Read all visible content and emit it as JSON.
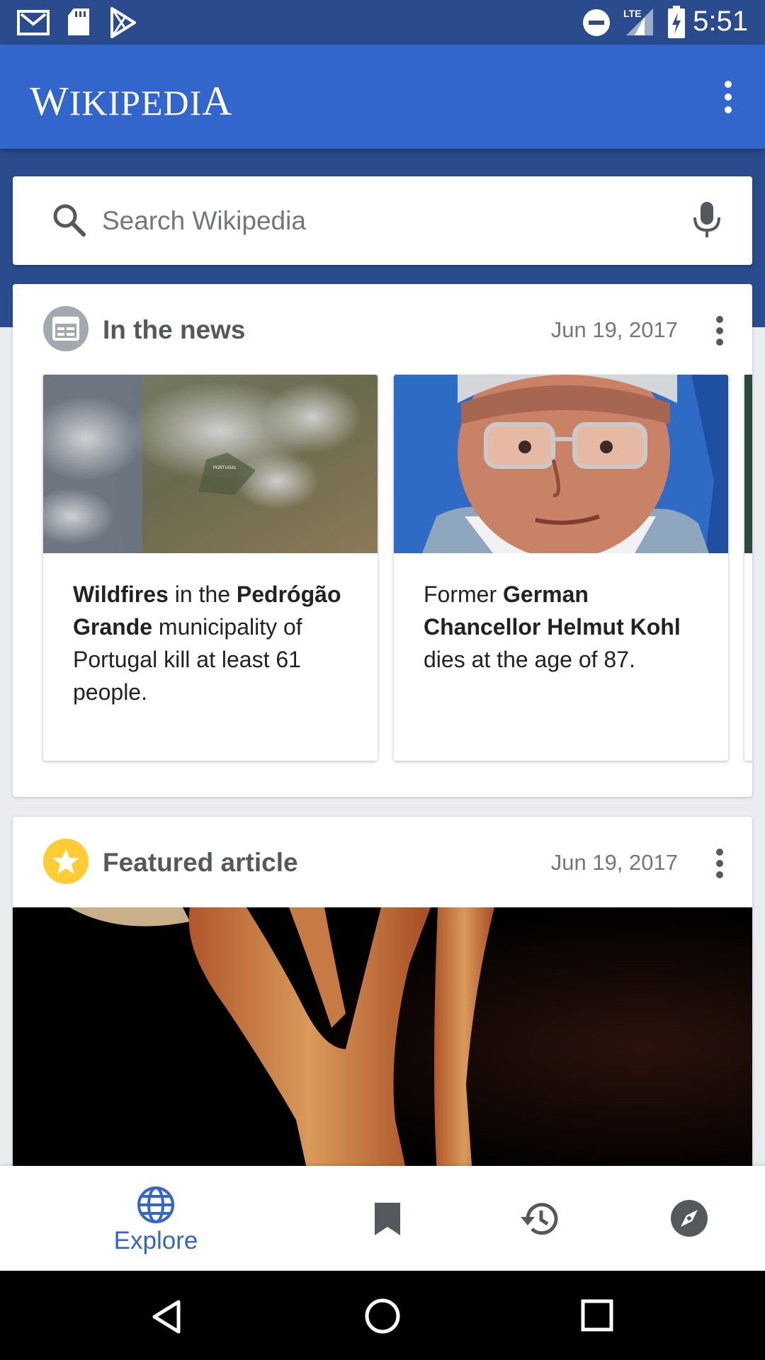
{
  "status_bar": {
    "time": "5:51",
    "network": "LTE",
    "icons": [
      "gmail-icon",
      "sd-card-icon",
      "play-store-icon",
      "do-not-disturb-icon",
      "signal-icon",
      "battery-charging-icon"
    ]
  },
  "app_bar": {
    "title_initial": "W",
    "title_mid": "IKIPEDI",
    "title_last": "A",
    "overflow_icon": "more-vert-icon"
  },
  "search": {
    "placeholder": "Search Wikipedia",
    "icons": [
      "search-icon",
      "mic-icon"
    ]
  },
  "news_card": {
    "title": "In the news",
    "date": "Jun 19, 2017",
    "items": [
      {
        "bold1": "Wildfires",
        "text1": " in the ",
        "bold2": "Pedrógão Grande",
        "text2": " municipality of Portugal kill at least 61 people.",
        "image_label": "PORTUGAL"
      },
      {
        "text1": "Former ",
        "bold1": "German Chancellor Helmut Kohl",
        "text2": " dies at the age of 87."
      }
    ]
  },
  "featured_card": {
    "title": "Featured article",
    "date": "Jun 19, 2017"
  },
  "bottom_nav": {
    "items": [
      {
        "label": "Explore",
        "icon": "globe-icon",
        "active": true
      },
      {
        "label": "",
        "icon": "bookmark-icon"
      },
      {
        "label": "",
        "icon": "history-icon"
      },
      {
        "label": "",
        "icon": "compass-icon"
      }
    ],
    "accent": "#3366cc"
  },
  "system_nav": {
    "icons": [
      "back-icon",
      "home-icon",
      "recents-icon"
    ]
  }
}
